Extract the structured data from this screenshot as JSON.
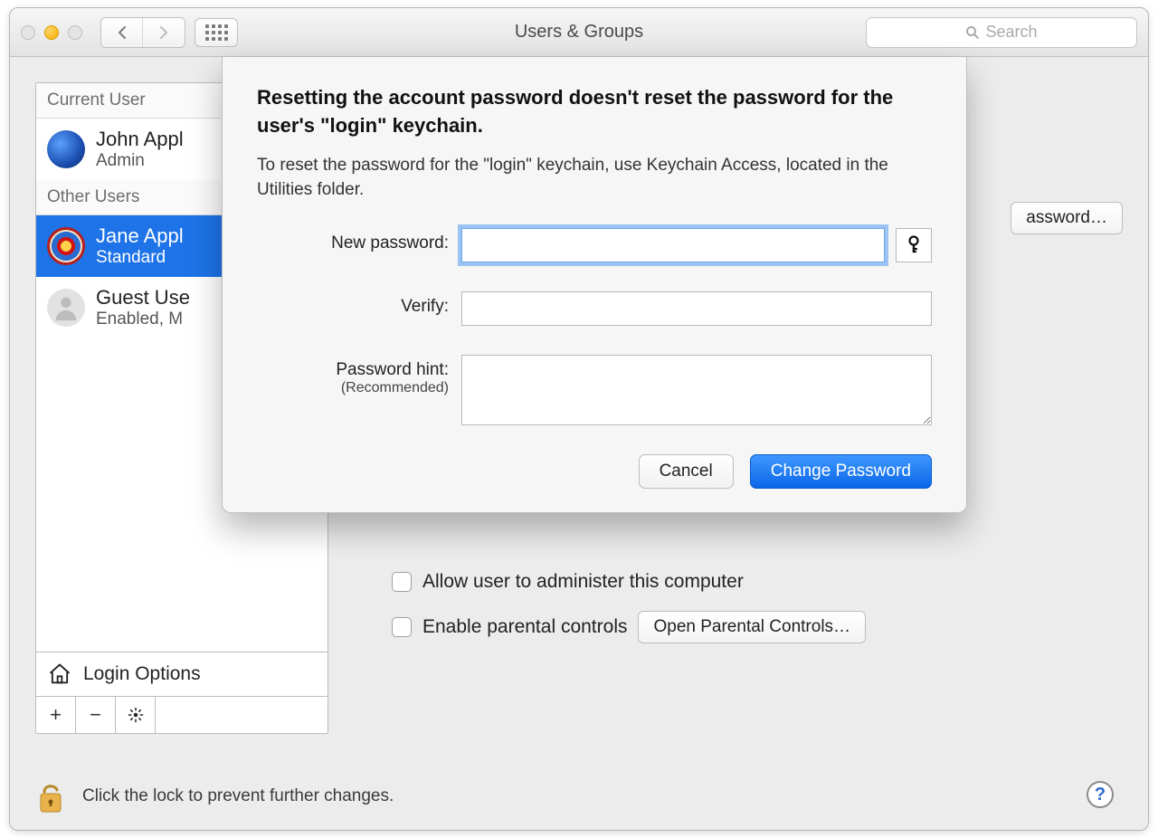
{
  "window": {
    "title": "Users & Groups",
    "search_placeholder": "Search"
  },
  "sidebar": {
    "current_header": "Current User",
    "other_header": "Other Users",
    "current_user": {
      "name": "John Appl",
      "role": "Admin"
    },
    "users": [
      {
        "name": "Jane Appl",
        "role": "Standard"
      },
      {
        "name": "Guest Use",
        "role": "Enabled, M"
      }
    ],
    "login_options": "Login Options"
  },
  "main": {
    "change_password_btn": "assword…",
    "allow_admin": "Allow user to administer this computer",
    "parental": "Enable parental controls",
    "open_parental": "Open Parental Controls…"
  },
  "lock": {
    "text": "Click the lock to prevent further changes."
  },
  "sheet": {
    "heading": "Resetting the account password doesn't reset the password for the user's \"login\" keychain.",
    "description": "To reset the password for the \"login\" keychain, use Keychain Access, located in the Utilities folder.",
    "new_password_label": "New password:",
    "verify_label": "Verify:",
    "hint_label": "Password hint:",
    "hint_sub": "(Recommended)",
    "cancel": "Cancel",
    "change": "Change Password"
  }
}
